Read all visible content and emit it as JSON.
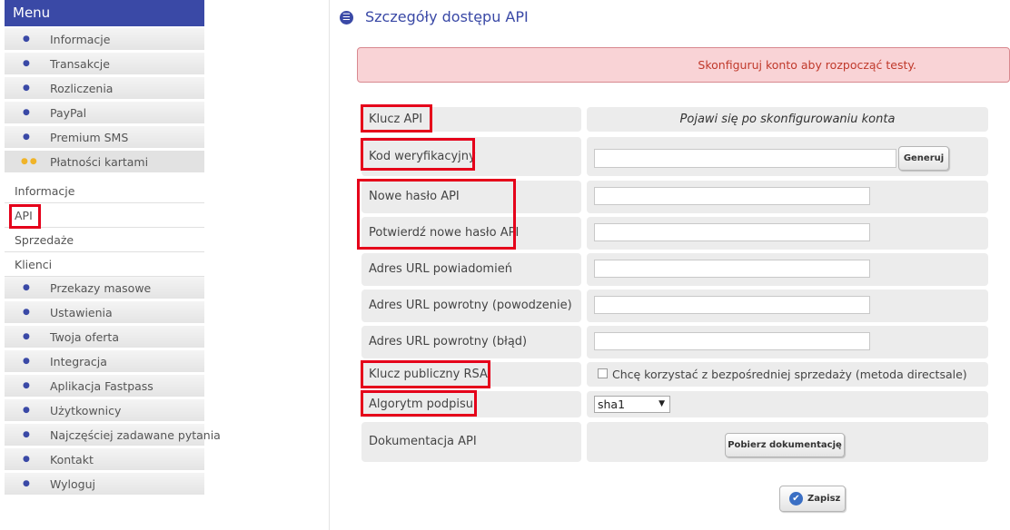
{
  "menu": {
    "header": "Menu",
    "items_top": [
      {
        "label": "Informacje"
      },
      {
        "label": "Transakcje"
      },
      {
        "label": "Rozliczenia"
      },
      {
        "label": "PayPal"
      },
      {
        "label": "Premium SMS"
      },
      {
        "label": "Płatności kartami",
        "active": true
      }
    ],
    "subitems": [
      {
        "label": "Informacje"
      },
      {
        "label": "API"
      },
      {
        "label": "Sprzedaże"
      },
      {
        "label": "Klienci"
      }
    ],
    "items_bottom": [
      {
        "label": "Przekazy masowe"
      },
      {
        "label": "Ustawienia"
      },
      {
        "label": "Twoja oferta"
      },
      {
        "label": "Integracja"
      },
      {
        "label": "Aplikacja Fastpass"
      },
      {
        "label": "Użytkownicy"
      },
      {
        "label": "Najczęściej zadawane pytania"
      },
      {
        "label": "Kontakt"
      },
      {
        "label": "Wyloguj"
      }
    ]
  },
  "page": {
    "title": "Szczegóły dostępu API",
    "alert": "Skonfiguruj konto aby rozpocząć testy."
  },
  "form": {
    "api_key_label": "Klucz API",
    "api_key_value": "Pojawi się po skonfigurowaniu konta",
    "verification_label": "Kod weryfikacyjny",
    "verification_value": "",
    "generate_button": "Generuj",
    "new_password_label": "Nowe hasło API",
    "new_password_value": "",
    "confirm_password_label": "Potwierdź nowe hasło API",
    "confirm_password_value": "",
    "notify_url_label": "Adres URL powiadomień",
    "notify_url_value": "",
    "return_url_success_label": "Adres URL powrotny (powodzenie)",
    "return_url_success_value": "",
    "return_url_error_label": "Adres URL powrotny (błąd)",
    "return_url_error_value": "",
    "rsa_key_label": "Klucz publiczny RSA",
    "rsa_checkbox_label": "Chcę korzystać z bezpośredniej sprzedaży (metoda directsale)",
    "signature_label": "Algorytm podpisu",
    "signature_value": "sha1",
    "docs_label": "Dokumentacja API",
    "docs_button": "Pobierz dokumentację",
    "save_button": "Zapisz"
  },
  "colors": {
    "menu_header_bg": "#3a49a6",
    "accent": "#3a49a6",
    "alert_bg": "#f9d3d6",
    "alert_text": "#c0392b",
    "highlight_box": "#e5001a",
    "active_bullet": "#f0b429"
  }
}
